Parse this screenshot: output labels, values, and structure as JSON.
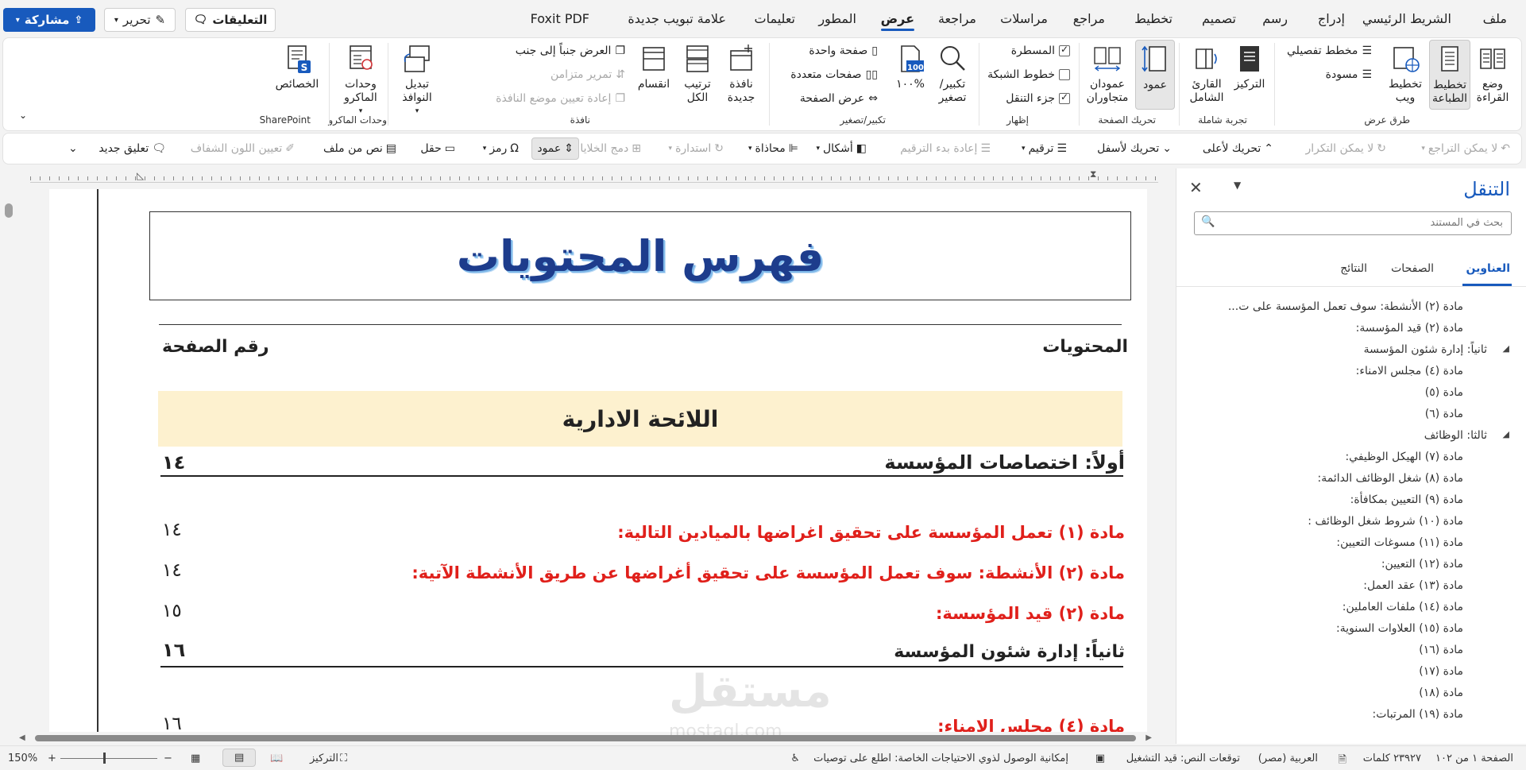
{
  "menubar": {
    "tabs": [
      "ملف",
      "الشريط الرئيسي",
      "إدراج",
      "رسم",
      "تصميم",
      "تخطيط",
      "مراجع",
      "مراسلات",
      "مراجعة",
      "عرض",
      "المطور",
      "تعليمات",
      "علامة تبويب جديدة",
      "Foxit PDF"
    ],
    "active_tab": "عرض",
    "share_label": "مشاركة",
    "edit_label": "تحرير",
    "comments_label": "التعليقات"
  },
  "ribbon": {
    "views": {
      "read_mode": "وضع القراءة",
      "print_layout": "تخطيط الطباعة",
      "web_layout": "تخطيط ويب",
      "outline": "مخطط تفصيلي",
      "draft": "مسودة",
      "group": "طرق عرض"
    },
    "immersive": {
      "focus": "التركيز",
      "reader": "القارئ الشامل",
      "group": "تجربة شاملة"
    },
    "page_movement": {
      "vertical": "عمود",
      "side_by_side": "عمودان متجاوران",
      "group": "تحريك الصفحة"
    },
    "show": {
      "ruler": "المسطرة",
      "gridlines": "خطوط الشبكة",
      "nav_pane": "جزء التنقل",
      "group": "إظهار",
      "ruler_checked": true,
      "gridlines_checked": false,
      "nav_checked": true
    },
    "zoom": {
      "zoom": "تكبير/ تصغير",
      "percent": "١٠٠%",
      "one_page": "صفحة واحدة",
      "multi_page": "صفحات متعددة",
      "page_width": "عرض الصفحة",
      "group": "تكبير/تصغير",
      "icon_num": "100"
    },
    "window": {
      "new_window": "نافذة جديدة",
      "arrange_all": "ترتيب الكل",
      "split": "انقسام",
      "side_by_side": "العرض جنباً إلى جنب",
      "sync_scroll": "تمرير متزامن",
      "reset_pos": "إعادة تعيين موضع النافذة",
      "switch": "تبديل النوافذ",
      "group": "نافذة"
    },
    "macros": {
      "label": "وحدات الماكرو",
      "group": "وحدات الماكرو"
    },
    "sharepoint": {
      "label": "الخصائص",
      "group": "SharePoint"
    }
  },
  "qat": {
    "undo": "لا يمكن التراجع",
    "redo": "لا يمكن التكرار",
    "move_up": "تحريك لأعلى",
    "move_down": "تحريك لأسفل",
    "numbering": "ترقيم",
    "restart_num": "إعادة بدء الترقيم",
    "shapes": "أشكال",
    "align": "محاذاة",
    "rotate": "استدارة",
    "merge": "دمج الخلايا",
    "column": "عمود",
    "symbol": "رمز",
    "field": "حقل",
    "text_from_file": "نص من ملف",
    "transparent": "تعيين اللون الشفاف",
    "new_comment": "تعليق جديد"
  },
  "document": {
    "title": "فهرس المحتويات",
    "col_contents": "المحتويات",
    "col_page": "رقم الصفحة",
    "section_banner": "اللائحة الادارية",
    "rows": [
      {
        "text": "أولاً: اختصاصات المؤسسة",
        "page": "١٤",
        "style": "heading"
      },
      {
        "text": "مادة (١) تعمل المؤسسة على تحقيق اغراضها بالميادين التالية:",
        "page": "١٤",
        "style": "red"
      },
      {
        "text": "مادة (٢) الأنشطة: سوف تعمل المؤسسة على تحقيق أغراضها عن طريق الأنشطة الآتية:",
        "page": "١٤",
        "style": "red"
      },
      {
        "text": "مادة (٢) قيد المؤسسة:",
        "page": "١٥",
        "style": "red"
      },
      {
        "text": "ثانياً: إدارة شئون المؤسسة",
        "page": "١٦",
        "style": "heading"
      },
      {
        "text": "مادة (٤) مجلس الامناء:",
        "page": "١٦",
        "style": "red"
      }
    ],
    "watermark": "مستقل",
    "watermark_sub": "mostaql.com"
  },
  "nav": {
    "title": "التنقل",
    "search_placeholder": "بحث في المستند",
    "tabs": [
      "العناوين",
      "الصفحات",
      "النتائج"
    ],
    "items": [
      {
        "text": "مادة (٢) الأنشطة: سوف تعمل المؤسسة على ت...",
        "level": 2
      },
      {
        "text": "مادة (٢) قيد المؤسسة:",
        "level": 2
      },
      {
        "text": "ثانياً: إدارة شئون المؤسسة",
        "level": 1
      },
      {
        "text": "مادة (٤) مجلس الامناء:",
        "level": 2
      },
      {
        "text": "مادة (٥)",
        "level": 2
      },
      {
        "text": "مادة (٦)",
        "level": 2
      },
      {
        "text": "ثالثا: الوظائف",
        "level": 1
      },
      {
        "text": "مادة (٧) الهيكل الوظيفي:",
        "level": 2
      },
      {
        "text": "مادة (٨) شغل الوظائف الدائمة:",
        "level": 2
      },
      {
        "text": "مادة (٩) التعيين بمكافأة:",
        "level": 2
      },
      {
        "text": "مادة (١٠) شروط شغل الوظائف :",
        "level": 2
      },
      {
        "text": "مادة (١١) مسوغات التعيين:",
        "level": 2
      },
      {
        "text": "مادة (١٢) التعيين:",
        "level": 2
      },
      {
        "text": "مادة (١٣) عقد العمل:",
        "level": 2
      },
      {
        "text": "مادة (١٤) ملفات العاملين:",
        "level": 2
      },
      {
        "text": "مادة (١٥) العلاوات السنوية:",
        "level": 2
      },
      {
        "text": "مادة (١٦)",
        "level": 2
      },
      {
        "text": "مادة (١٧)",
        "level": 2
      },
      {
        "text": "مادة (١٨)",
        "level": 2
      },
      {
        "text": "مادة (١٩) المرتبات:",
        "level": 2
      }
    ]
  },
  "status": {
    "page": "الصفحة ١ من ١٠٢",
    "words": "٢٣٩٢٧ كلمات",
    "language": "العربية (مصر)",
    "predictions": "توقعات النص: قيد التشغيل",
    "accessibility": "إمكانية الوصول لذوي الاحتياجات الخاصة: اطلع على توصيات",
    "focus": "التركيز",
    "zoom": "150%"
  }
}
